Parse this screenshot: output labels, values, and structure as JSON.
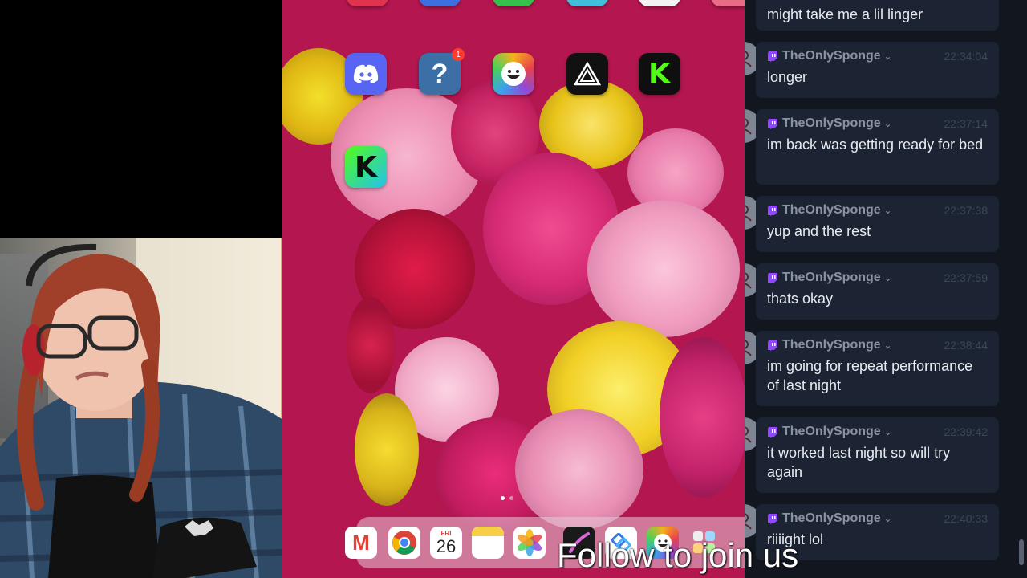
{
  "phone": {
    "home_apps": [
      {
        "name": "Discord",
        "icon": "discord-icon",
        "color": "#5865f2"
      },
      {
        "name": "Help",
        "icon": "question-icon",
        "color": "#3b6fa6",
        "badge": "1"
      },
      {
        "name": "Trivia Crack",
        "icon": "trivia-icon",
        "color": "#f5b21c"
      },
      {
        "name": "Prisma",
        "icon": "triangle-icon",
        "color": "#111111"
      },
      {
        "name": "Kick",
        "icon": "kick-icon",
        "color": "#0f0f0f"
      },
      {
        "name": "Kick Studio",
        "icon": "kick-icon",
        "color": "#53fc18"
      }
    ],
    "dock": {
      "calendar_day": "FRI",
      "calendar_date": "26",
      "apps": [
        "gmail-icon",
        "chrome-icon",
        "calendar-icon",
        "notes-icon",
        "photos-icon",
        "pen-icon",
        "link-icon",
        "games-icon",
        "app-library-icon"
      ]
    }
  },
  "chat": {
    "messages": [
      {
        "user": "",
        "time": "",
        "text": "might take me a lil linger"
      },
      {
        "user": "TheOnlySponge",
        "time": "22:34:04",
        "text": "longer"
      },
      {
        "user": "TheOnlySponge",
        "time": "22:37:14",
        "text": "im back was getting ready for bed"
      },
      {
        "user": "TheOnlySponge",
        "time": "22:37:38",
        "text": "yup and the rest"
      },
      {
        "user": "TheOnlySponge",
        "time": "22:37:59",
        "text": "thats okay"
      },
      {
        "user": "TheOnlySponge",
        "time": "22:38:44",
        "text": "im going for repeat performance of last night"
      },
      {
        "user": "TheOnlySponge",
        "time": "22:39:42",
        "text": "it worked last night so will try again"
      },
      {
        "user": "TheOnlySponge",
        "time": "22:40:33",
        "text": "riiiight lol"
      }
    ]
  },
  "overlay_text": "Follow to join us",
  "colors": {
    "chat_bg": "#12161f",
    "bubble_bg": "#1c2434",
    "twitch_purple": "#9146ff"
  }
}
